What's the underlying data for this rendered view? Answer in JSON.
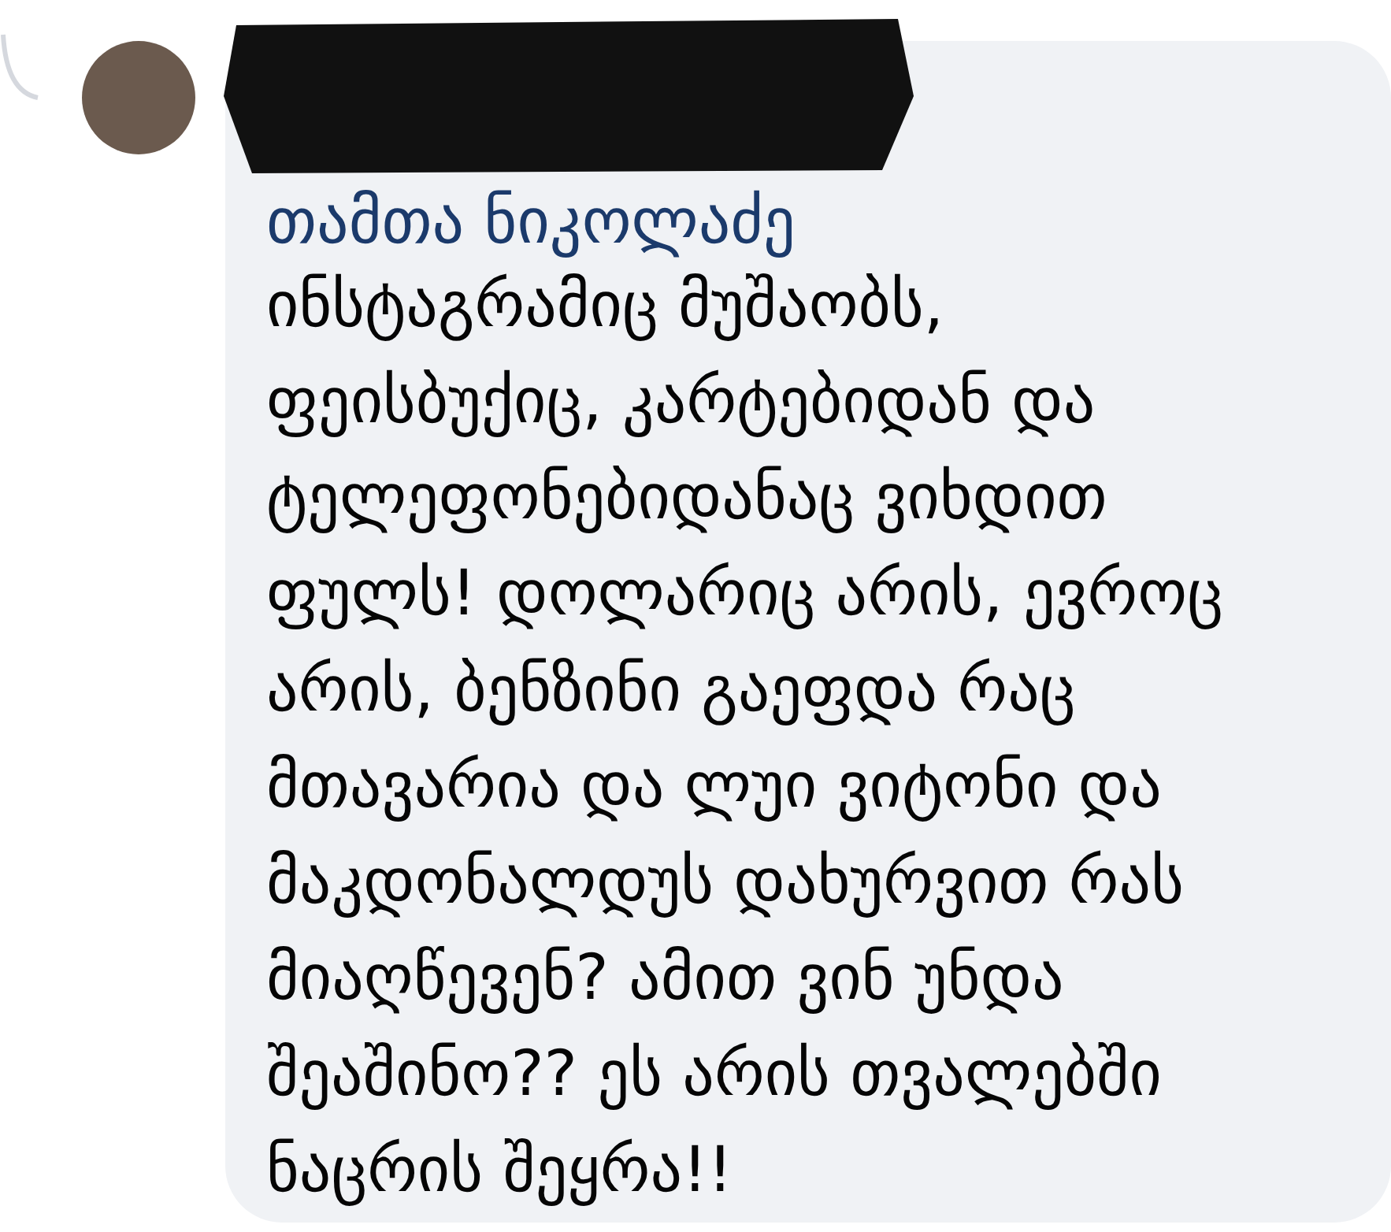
{
  "comment": {
    "mention": "თამთა ნიკოლაძე",
    "text": "ინსტაგრამიც მუშაობს, ფეისბუქიც, კარტებიდან და ტელეფონებიდანაც ვიხდით ფულს! დოლარიც არის, ევროც არის, ბენზინი გაეფდა რაც მთავარია და ლუი ვიტონი და მაკდონალდუს დახურვით რას მიაღწევენ? ამით ვინ უნდა შეაშინო?? ეს არის თვალებში ნაცრის შეყრა!!",
    "author_redacted": true
  }
}
